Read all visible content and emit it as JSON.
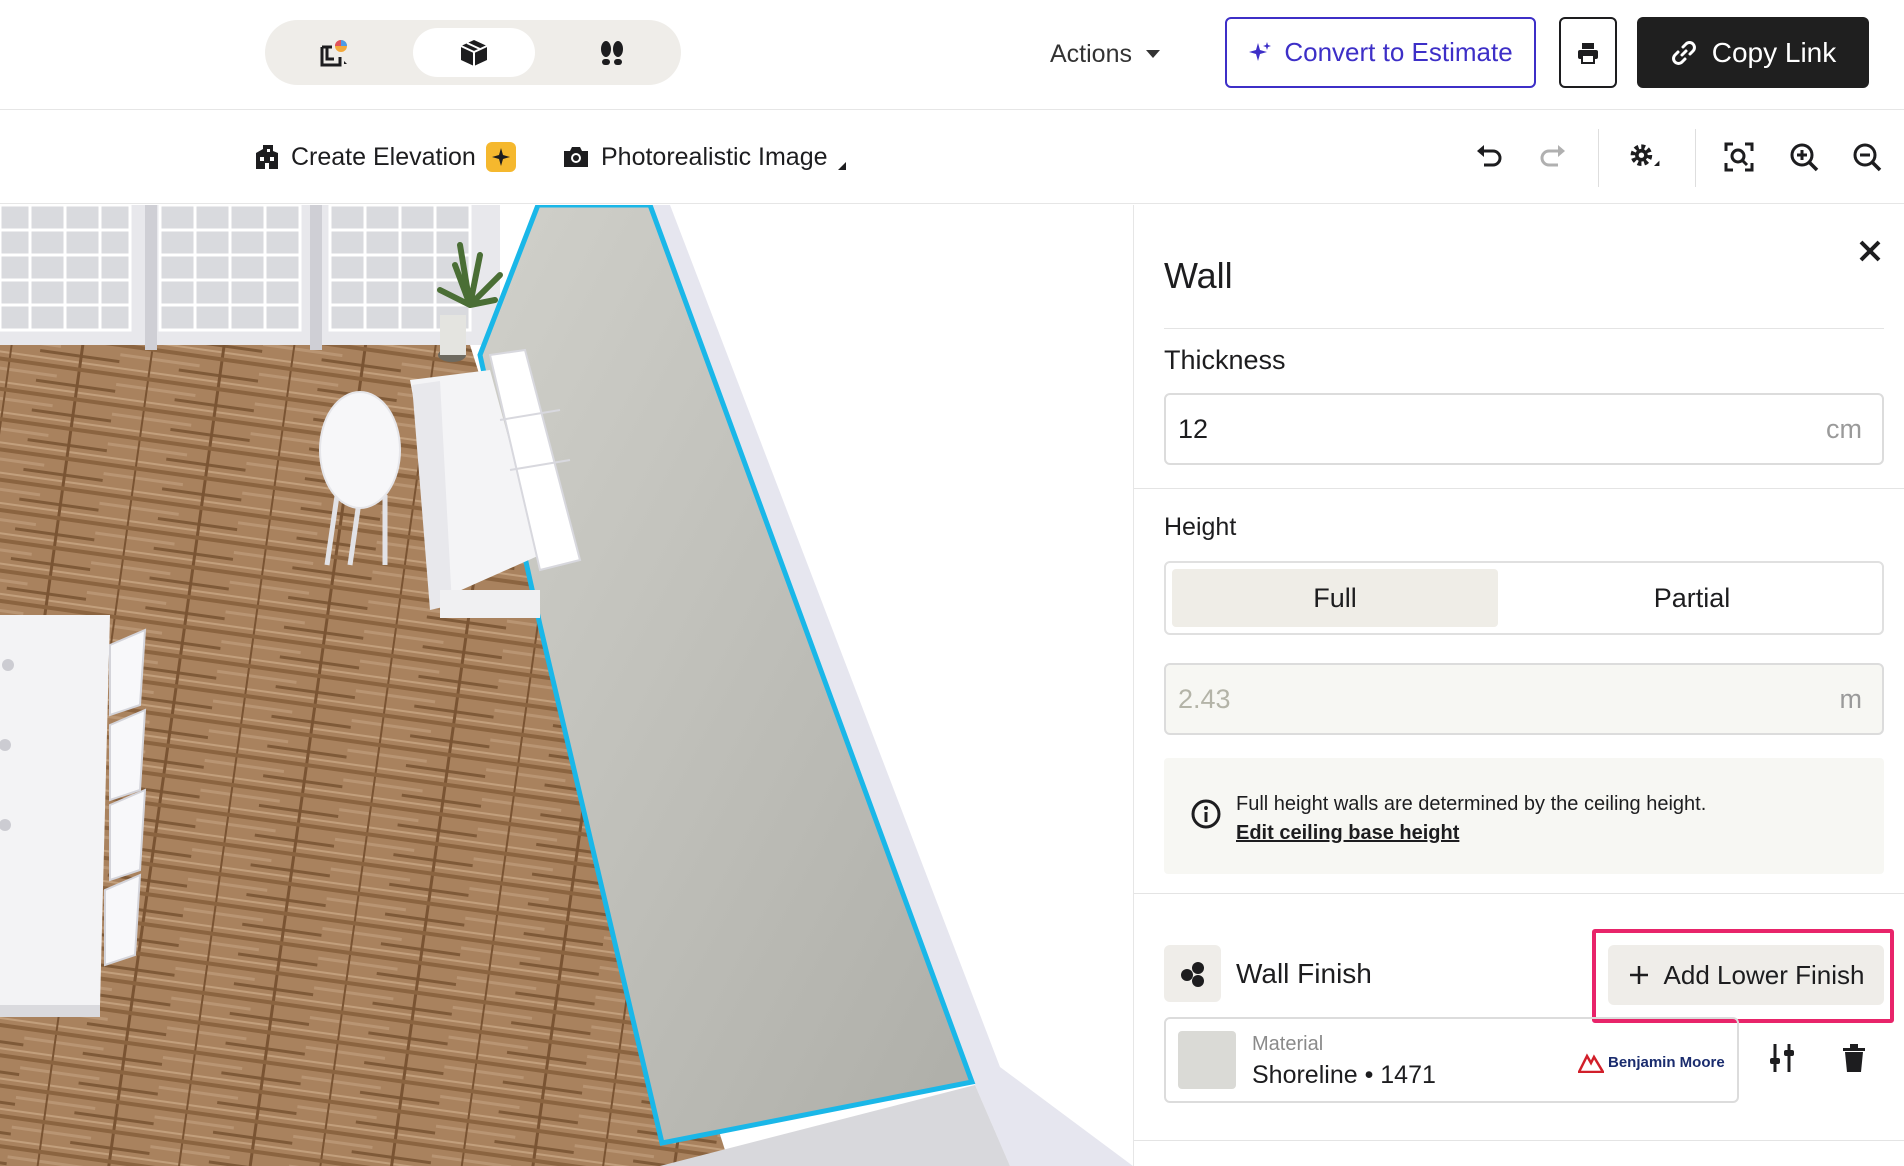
{
  "topbar": {
    "view_modes": [
      {
        "icon": "floorplan-2d-icon",
        "active": false
      },
      {
        "icon": "box-3d-icon",
        "active": true
      },
      {
        "icon": "walkthrough-footsteps-icon",
        "active": false
      }
    ],
    "actions_label": "Actions",
    "convert_label": "Convert to Estimate",
    "print_icon": "printer-icon",
    "copy_link_label": "Copy Link",
    "accent_color": "#3d2fc7"
  },
  "toolbar": {
    "create_elevation_label": "Create Elevation",
    "photorealistic_label": "Photorealistic Image",
    "icons": [
      "undo-icon",
      "redo-icon",
      "settings-gear-icon",
      "fit-view-icon",
      "zoom-in-icon",
      "zoom-out-icon"
    ]
  },
  "panel": {
    "title": "Wall",
    "thickness": {
      "label": "Thickness",
      "value": "12",
      "unit": "cm"
    },
    "height": {
      "label": "Height",
      "options": [
        "Full",
        "Partial"
      ],
      "selected": "Full",
      "value": "2.43",
      "unit": "m"
    },
    "info": {
      "text": "Full height walls are determined by the ceiling height.",
      "link": "Edit ceiling base height"
    },
    "wall_finish": {
      "label": "Wall Finish",
      "add_lower_label": "Add Lower Finish",
      "highlight_color": "#e8246a",
      "material": {
        "label": "Material",
        "name": "Shoreline • 1471",
        "brand": "Benjamin Moore",
        "swatch_color": "#dadad6"
      }
    }
  }
}
